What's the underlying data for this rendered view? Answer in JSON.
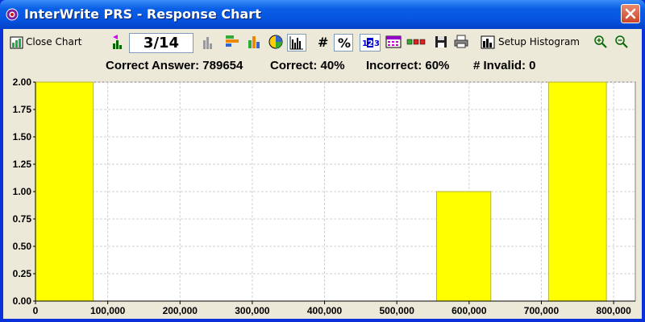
{
  "window": {
    "title": "InterWrite PRS - Response Chart"
  },
  "toolbar": {
    "close_chart_label": "Close Chart",
    "page_indicator": "3/14",
    "number_label": "#",
    "percent_label": "%",
    "setup_histogram_label": "Setup Histogram"
  },
  "summary": {
    "correct_answer": "Correct Answer: 789654",
    "correct": "Correct: 40%",
    "incorrect": "Incorrect: 60%",
    "invalid": "# Invalid: 0"
  },
  "colors": {
    "bar_fill": "#ffff00",
    "bar_stroke": "#b5b532",
    "title_bar": "#0a5fe6"
  },
  "chart_data": {
    "type": "bar",
    "title": "",
    "xlabel": "",
    "ylabel": "",
    "bars": [
      {
        "x_start": 0,
        "x_end": 80000,
        "value": 2.0
      },
      {
        "x_start": 555000,
        "x_end": 630000,
        "value": 1.0
      },
      {
        "x_start": 710000,
        "x_end": 790000,
        "value": 2.0
      }
    ],
    "xlim": [
      0,
      830000
    ],
    "ylim": [
      0,
      2.0
    ],
    "x_ticks": [
      0,
      100000,
      200000,
      300000,
      400000,
      500000,
      600000,
      700000,
      800000
    ],
    "x_tick_labels": [
      "0",
      "100,000",
      "200,000",
      "300,000",
      "400,000",
      "500,000",
      "600,000",
      "700,000",
      "800,000"
    ],
    "y_ticks": [
      0,
      0.25,
      0.5,
      0.75,
      1.0,
      1.25,
      1.5,
      1.75,
      2.0
    ],
    "y_tick_labels": [
      "0.00",
      "0.25",
      "0.50",
      "0.75",
      "1.00",
      "1.25",
      "1.50",
      "1.75",
      "2.00"
    ],
    "grid": true,
    "legend": "none"
  }
}
